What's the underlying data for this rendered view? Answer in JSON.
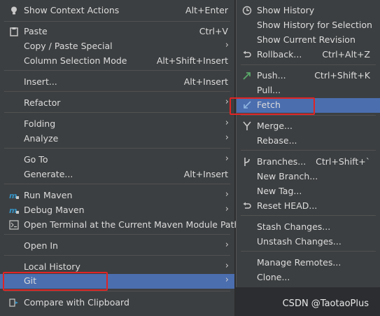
{
  "left_menu": {
    "items": [
      {
        "label": "Show Context Actions",
        "shortcut": "Alt+Enter",
        "icon": "lightbulb-icon"
      },
      {
        "label": "Paste",
        "shortcut": "Ctrl+V",
        "icon": "clipboard-icon"
      },
      {
        "label": "Copy / Paste Special",
        "submenu": true
      },
      {
        "label": "Column Selection Mode",
        "shortcut": "Alt+Shift+Insert"
      },
      {
        "label": "Insert...",
        "shortcut": "Alt+Insert"
      },
      {
        "label": "Refactor",
        "submenu": true
      },
      {
        "label": "Folding",
        "submenu": true
      },
      {
        "label": "Analyze",
        "submenu": true
      },
      {
        "label": "Go To",
        "submenu": true
      },
      {
        "label": "Generate...",
        "shortcut": "Alt+Insert"
      },
      {
        "label": "Run Maven",
        "submenu": true,
        "icon": "maven-icon"
      },
      {
        "label": "Debug Maven",
        "submenu": true,
        "icon": "maven-icon"
      },
      {
        "label": "Open Terminal at the Current Maven Module Path",
        "icon": "terminal-icon"
      },
      {
        "label": "Open In",
        "submenu": true
      },
      {
        "label": "Local History",
        "submenu": true
      },
      {
        "label": "Git",
        "submenu": true,
        "selected": true
      },
      {
        "label": "Compare with Clipboard",
        "icon": "compare-icon"
      }
    ]
  },
  "right_menu": {
    "items": [
      {
        "label": "Show History",
        "icon": "clock-icon"
      },
      {
        "label": "Show History for Selection"
      },
      {
        "label": "Show Current Revision"
      },
      {
        "label": "Rollback...",
        "shortcut": "Ctrl+Alt+Z",
        "icon": "rollback-icon"
      },
      {
        "label": "Push...",
        "shortcut": "Ctrl+Shift+K",
        "icon": "push-icon"
      },
      {
        "label": "Pull..."
      },
      {
        "label": "Fetch",
        "icon": "fetch-icon",
        "selected": true
      },
      {
        "label": "Merge...",
        "icon": "merge-icon"
      },
      {
        "label": "Rebase..."
      },
      {
        "label": "Branches...",
        "shortcut": "Ctrl+Shift+`",
        "icon": "branch-icon"
      },
      {
        "label": "New Branch..."
      },
      {
        "label": "New Tag..."
      },
      {
        "label": "Reset HEAD...",
        "icon": "rollback-icon"
      },
      {
        "label": "Stash Changes..."
      },
      {
        "label": "Unstash Changes..."
      },
      {
        "label": "Manage Remotes..."
      },
      {
        "label": "Clone..."
      }
    ]
  },
  "watermark": "CSDN @TaotaoPlus",
  "colors": {
    "menu_bg": "#3c3f41",
    "selection": "#4b6eaf",
    "highlight_box": "#e02424",
    "push_icon": "#59a869",
    "maven_icon": "#3592c4"
  }
}
